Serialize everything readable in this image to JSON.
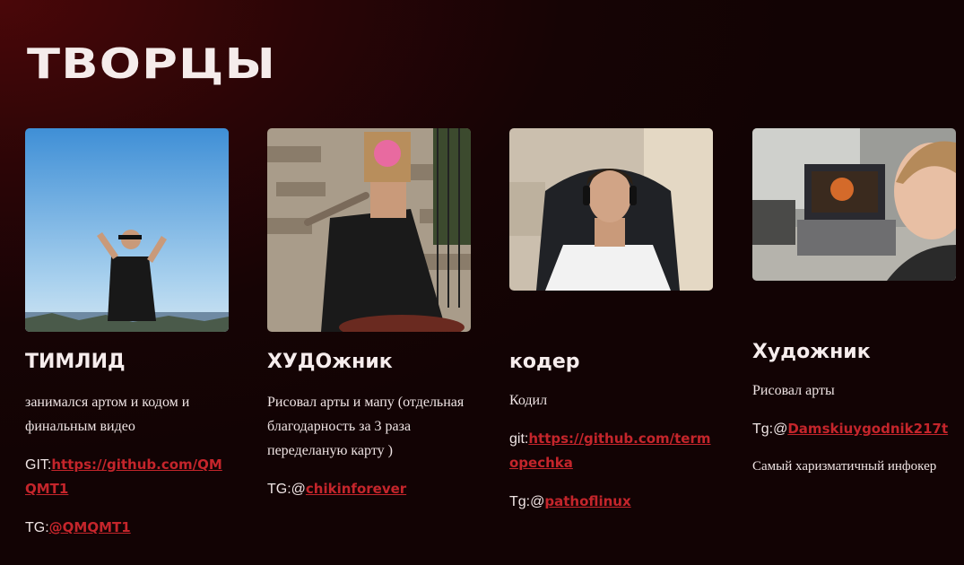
{
  "title": "ТВОРЦЫ",
  "accent_color": "#c4252b",
  "members": [
    {
      "role": "ТИМЛИД",
      "description": "занимался артом и кодом и финальным видео",
      "git_label": "GIT:",
      "git_link": "https://github.com/QMQMT1",
      "tg_label": "TG:",
      "tg_link": "@QMQMT1"
    },
    {
      "role": "ХУДОжник",
      "description": "Рисовал арты и мапу (отдельная благодарность за 3 раза переделаную карту )",
      "tg_label": "TG:@",
      "tg_link": "chikinforever"
    },
    {
      "role": "кодер",
      "description": "Кодил",
      "git_label": "git:",
      "git_link": "https://github.com/termopechka",
      "tg_label": "Tg:@",
      "tg_link": "pathoflinux"
    },
    {
      "role": "Художник",
      "description": "Рисовал арты",
      "tg_label": "Tg:@",
      "tg_link": "Damskiuygodnik217t",
      "extra": "Самый харизматичный инфокер"
    }
  ]
}
